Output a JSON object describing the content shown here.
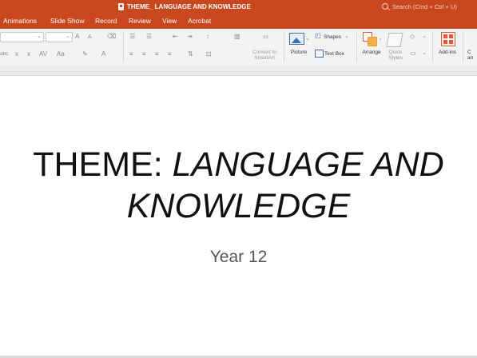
{
  "window": {
    "document_title": "THEME_ LANGUAGE AND KNOWLEDGE"
  },
  "search": {
    "placeholder": "Search (Cmd + Ctrl + U)"
  },
  "menu": {
    "items": [
      "Animations",
      "Slide Show",
      "Record",
      "Review",
      "View",
      "Acrobat"
    ]
  },
  "ribbon": {
    "smartart_line1": "Convert to",
    "smartart_line2": "SmartArt",
    "picture": "Picture",
    "shapes": "Shapes",
    "text_box": "Text Box",
    "arrange": "Arrange",
    "quick_styles_line1": "Quick",
    "quick_styles_line2": "Styles",
    "add_ins": "Add-ins",
    "partial_line1": "C",
    "partial_line2": "an",
    "font_size_up": "A",
    "font_size_down": "A",
    "char_spacing": "AV",
    "change_case": "Aa",
    "font_color": "A",
    "superscript": "x",
    "subscript": "x",
    "strike": "abc"
  },
  "slide": {
    "title_line1_regular": "THEME: ",
    "title_line1_italic": "LANGUAGE AND",
    "title_line2_italic": "KNOWLEDGE",
    "subtitle": "Year 12"
  },
  "colors": {
    "titlebar": "#c8471f",
    "ribbon": "#f3f3f3",
    "accent_icon": "#e05a3a",
    "picture_icon": "#3b6fb6"
  }
}
